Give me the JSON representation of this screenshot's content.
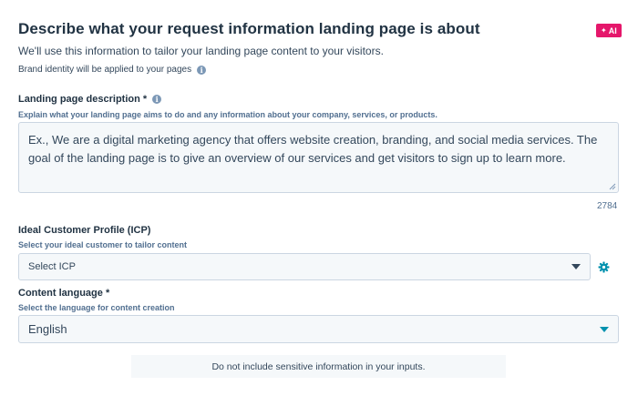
{
  "header": {
    "title": "Describe what your request information landing page is about",
    "ai_badge": "AI",
    "subtitle": "We'll use this information to tailor your landing page content to your visitors.",
    "brand_note": "Brand identity will be applied to your pages"
  },
  "description": {
    "label": "Landing page description *",
    "help": "Explain what your landing page aims to do and any information about your company, services, or products.",
    "value": "Ex., We are a digital marketing agency that offers website creation, branding, and social media services. The goal of the landing page is to give an overview of our services and get visitors to sign up to learn more.",
    "counter": "2784"
  },
  "icp": {
    "label": "Ideal Customer Profile (ICP)",
    "help": "Select your ideal customer to tailor content",
    "selected": "Select ICP"
  },
  "language": {
    "label": "Content language *",
    "help": "Select the language for content creation",
    "selected": "English"
  },
  "notice": "Do not include sensitive information in your inputs.",
  "colors": {
    "accent": "#0091ae",
    "ai_badge": "#e5176b",
    "heading": "#213343",
    "text": "#33475b",
    "field_bg": "#f5f8fa"
  },
  "icons": [
    "sparkle-icon",
    "info-icon",
    "resize-handle-icon",
    "chevron-down-icon",
    "gear-icon"
  ]
}
